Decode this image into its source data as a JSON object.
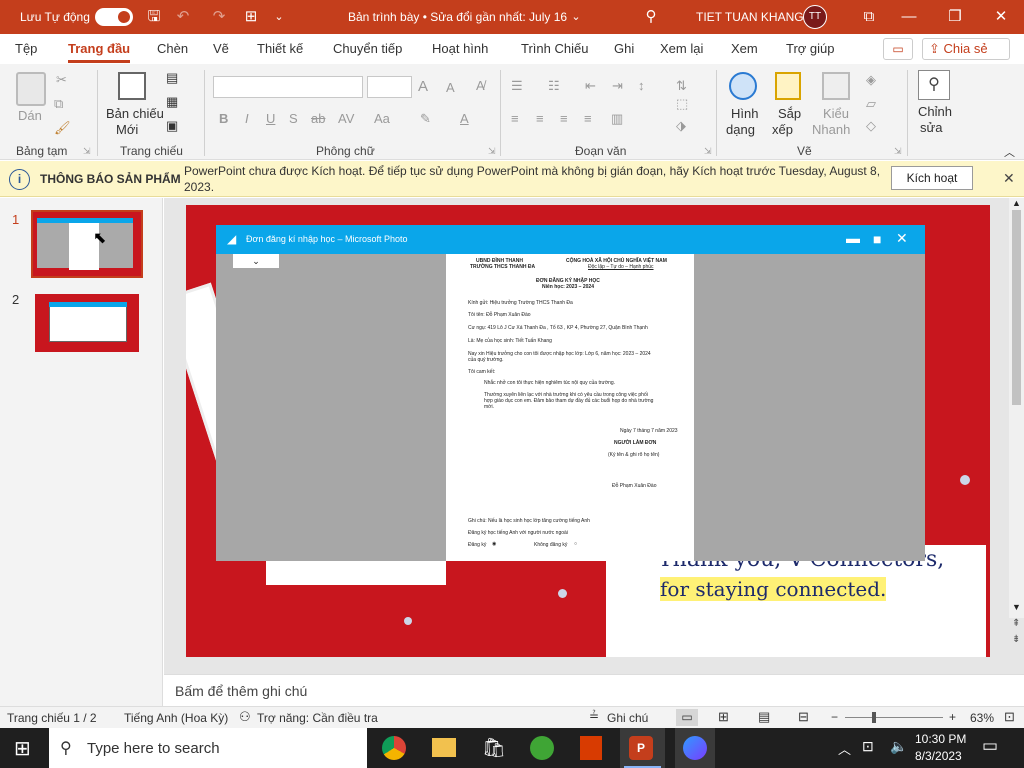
{
  "titlebar": {
    "autosave_label": "Lưu Tự động",
    "doc_title": "Bản trình bày • Sửa đổi gần nhất: July 16",
    "user_name": "TIET TUAN KHANG",
    "user_initials": "TT"
  },
  "tabs": [
    "Tệp",
    "Trang đầu",
    "Chèn",
    "Vẽ",
    "Thiết kế",
    "Chuyển tiếp",
    "Hoạt hình",
    "Trình Chiếu",
    "Ghi",
    "Xem lại",
    "Xem",
    "Trợ giúp"
  ],
  "share_label": "Chia sẻ",
  "ribbon": {
    "clipboard": {
      "paste": "Dán",
      "group": "Bảng tạm"
    },
    "slides": {
      "new_slide_1": "Bản chiếu",
      "new_slide_2": "Mới",
      "group": "Trang chiếu"
    },
    "font": {
      "group": "Phông chữ",
      "bold": "B",
      "italic": "I",
      "underline": "U",
      "strike": "ab",
      "case": "Aa",
      "grow": "A",
      "shrink": "A"
    },
    "paragraph": {
      "group": "Đoạn văn"
    },
    "drawing": {
      "shape_1": "Hình",
      "shape_2": "dạng",
      "arrange_1": "Sắp",
      "arrange_2": "xếp",
      "styles_1": "Kiểu",
      "styles_2": "Nhanh",
      "group": "Vẽ"
    },
    "editing": {
      "edit_1": "Chỉnh",
      "edit_2": "sửa"
    }
  },
  "notification": {
    "title": "THÔNG BÁO SẢN PHẨM",
    "line1": "PowerPoint chưa được Kích hoạt. Để tiếp tục sử dụng PowerPoint mà không bị gián đoạn, hãy Kích hoạt trước Tuesday, August 8,",
    "line2": "2023.",
    "button": "Kích hoạt"
  },
  "thumbnails": [
    {
      "number": "1"
    },
    {
      "number": "2"
    }
  ],
  "photo_window": {
    "title": "Đơn đăng kí nhập học – Microsoft Photo"
  },
  "document": {
    "left_header_1": "UBND ĐÌNH THANH",
    "left_header_2": "TRƯỜNG THCS THANH ĐA",
    "right_header_1": "CỘNG HOÀ XÃ HỘI CHỦ NGHĨA VIỆT NAM",
    "right_header_2": "Độc lập – Tự do – Hạnh phúc",
    "title": "ĐƠN ĐĂNG KÝ NHẬP HỌC",
    "subtitle": "Niên học: 2023 – 2024",
    "to": "Kính gửi: Hiệu trưởng Trường THCS Thanh Đa",
    "name": "Tôi tên: Đỗ Phạm Xuân Đào",
    "address": "Cư ngụ: 419 Lô J Cư Xá Thanh Đa , Tổ 63 , KP 4, Phường 27, Quận Bình Thạnh",
    "relation": "Là: Mẹ của học sinh: Tiết Tuấn Khang",
    "request_1": "Nay xin Hiệu trưởng cho con tôi được nhập học lớp: Lớp 6, năm học: 2023 – 2024",
    "request_2": "của quý trường.",
    "commit": "Tôi cam kết:",
    "bullet_1": "Nhắc nhở con tôi thực hiện nghiêm túc nội quy của trường.",
    "bullet_2a": "Thường xuyên liên lạc với nhà trường khi có yêu cầu trong công việc phối",
    "bullet_2b": "hợp giáo dục con em. Đảm bảo tham dự đầy đủ các buổi họp do nhà trường",
    "bullet_2c": "mời.",
    "date": "Ngày 7 tháng 7 năm 2023",
    "signer_title": "NGƯỜI LÀM ĐƠN",
    "signer_note": "(Ký tên & ghi rõ họ tên)",
    "signer_name": "Đỗ Phạm Xuân Đào",
    "note": "Ghi chú: Nếu là học sinh học lớp tăng cường tiếng Anh",
    "note_2": "Đăng ký học tiếng Anh với người nước ngoài",
    "opt_yes": "Đăng ký",
    "opt_no": "Không đăng ký"
  },
  "slide_text": {
    "line1": "Thank you, V-Connectors,",
    "line2": "for staying connected."
  },
  "notes_placeholder": "Bấm để thêm ghi chú",
  "status": {
    "slide_info": "Trang chiếu 1 / 2",
    "language": "Tiếng Anh (Hoa Kỳ)",
    "accessibility": "Trợ năng: Cần điều tra",
    "notes_btn": "Ghi chú",
    "zoom": "63%"
  },
  "taskbar": {
    "search_placeholder": "Type here to search",
    "time": "10:30 PM",
    "date": "8/3/2023"
  }
}
